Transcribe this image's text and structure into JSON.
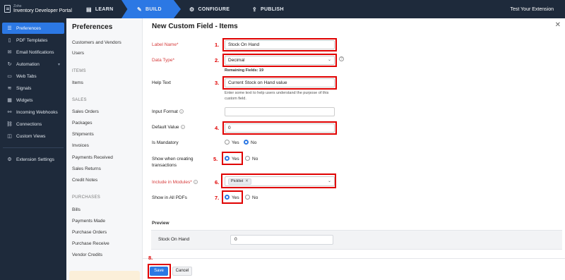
{
  "app": {
    "logo_small": "Zoho",
    "logo_text": "Inventory Developer Portal",
    "test_extension": "Test Your Extension"
  },
  "steps": [
    {
      "label": "LEARN",
      "icon": "book-icon"
    },
    {
      "label": "BUILD",
      "icon": "wrench-icon"
    },
    {
      "label": "CONFIGURE",
      "icon": "gear-icon"
    },
    {
      "label": "PUBLISH",
      "icon": "upload-icon"
    }
  ],
  "sidebar": {
    "items": [
      {
        "label": "Preferences",
        "icon": "sliders-icon"
      },
      {
        "label": "PDF Templates",
        "icon": "document-icon"
      },
      {
        "label": "Email Notifications",
        "icon": "mail-icon"
      },
      {
        "label": "Automation",
        "icon": "automation-icon"
      },
      {
        "label": "Web Tabs",
        "icon": "tabs-icon"
      },
      {
        "label": "Signals",
        "icon": "signal-icon"
      },
      {
        "label": "Widgets",
        "icon": "widget-icon"
      },
      {
        "label": "Incoming Webhooks",
        "icon": "webhook-icon"
      },
      {
        "label": "Connections",
        "icon": "link-icon"
      },
      {
        "label": "Custom Views",
        "icon": "view-icon"
      }
    ],
    "extension_settings": "Extension Settings"
  },
  "prefs": {
    "title": "Preferences",
    "links": {
      "customers_vendors": "Customers and Vendors",
      "users": "Users",
      "items_head": "ITEMS",
      "items": "Items",
      "sales_head": "SALES",
      "sales_orders": "Sales Orders",
      "packages": "Packages",
      "shipments": "Shipments",
      "invoices": "Invoices",
      "payments_received": "Payments Received",
      "sales_returns": "Sales Returns",
      "credit_notes": "Credit Notes",
      "purchases_head": "PURCHASES",
      "bills": "Bills",
      "payments_made": "Payments Made",
      "purchase_orders": "Purchase Orders",
      "purchase_receive": "Purchase Receive",
      "vendor_credits": "Vendor Credits"
    }
  },
  "form": {
    "title": "New Custom Field - Items",
    "label_name": {
      "label": "Label Name*",
      "value": "Stock On Hand"
    },
    "data_type": {
      "label": "Data Type*",
      "value": "Decimal",
      "remaining": "Remaining Fields: 19"
    },
    "help_text": {
      "label": "Help Text",
      "value": "Current Stock on Hand value",
      "hint": "Enter some text to help users understand the purpose of this custom field."
    },
    "input_format": {
      "label": "Input Format",
      "value": ""
    },
    "default_value": {
      "label": "Default Value",
      "value": "0"
    },
    "is_mandatory": {
      "label": "Is Mandatory",
      "yes": "Yes",
      "no": "No",
      "selected": "No"
    },
    "show_when_creating": {
      "label": "Show when creating transactions",
      "yes": "Yes",
      "no": "No",
      "selected": "Yes"
    },
    "include_in_modules": {
      "label": "Include in Modules*",
      "tag": "Picklist"
    },
    "show_in_pdfs": {
      "label": "Show in All PDFs",
      "yes": "Yes",
      "no": "No",
      "selected": "Yes"
    },
    "preview": {
      "label": "Preview",
      "field": "Stock On Hand",
      "value": "0"
    },
    "save": "Save",
    "cancel": "Cancel"
  },
  "annotations": [
    "1.",
    "2.",
    "3.",
    "4.",
    "5.",
    "6.",
    "7.",
    "8."
  ],
  "colors": {
    "accent": "#2c78e4",
    "callout": "#e00000",
    "sidebar_bg": "#1e2a3b"
  }
}
